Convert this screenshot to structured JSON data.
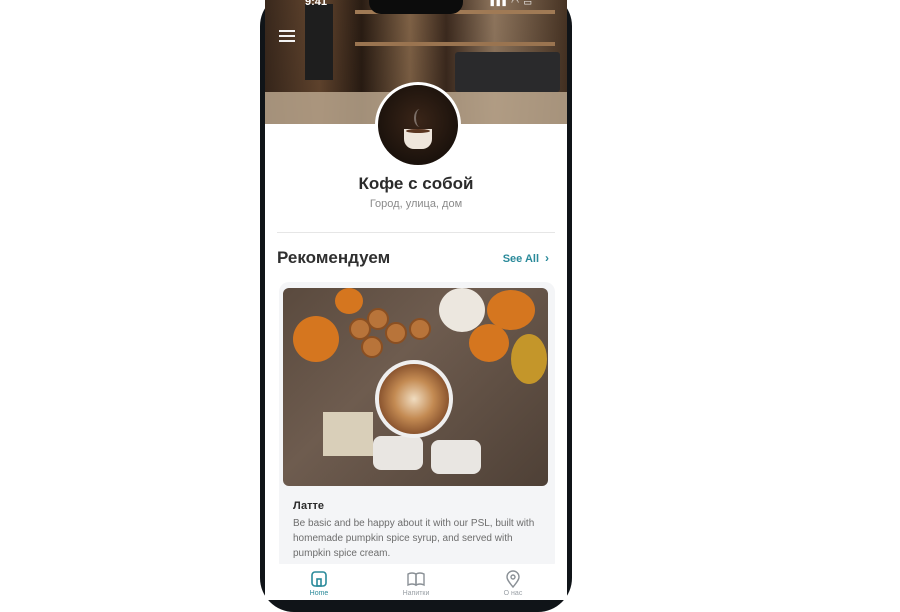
{
  "status_bar": {
    "time": "9:41",
    "icons": "▮▮▮ ◠ ▭"
  },
  "shop": {
    "name": "Кофе с собой",
    "address": "Город, улица, дом"
  },
  "recommend": {
    "title": "Рекомендуем",
    "see_all": "See All",
    "card": {
      "title": "Латте",
      "description": "Be basic and be happy about it with our PSL, built with homemade pumpkin spice syrup, and served with pumpkin spice cream."
    }
  },
  "tabs": [
    {
      "label": "Home",
      "icon": "home-icon"
    },
    {
      "label": "Напитки",
      "icon": "book-icon"
    },
    {
      "label": "О нас",
      "icon": "location-pin-icon"
    }
  ],
  "colors": {
    "accent": "#2a8a9a",
    "text": "#2b2b2b",
    "muted": "#8a8a8a"
  }
}
